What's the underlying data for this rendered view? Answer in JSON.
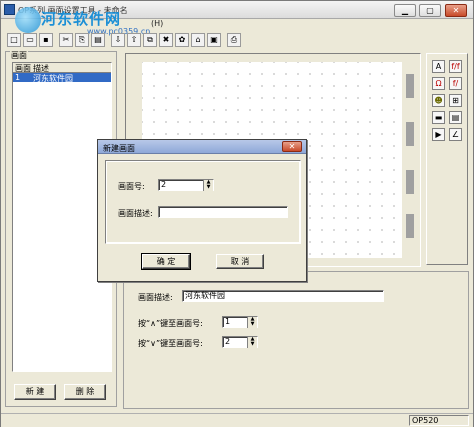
{
  "window": {
    "title": "OP系列 画面设置工具 - 未命名",
    "menu_fragment": "(H)",
    "buttons": {
      "minimize": "▁",
      "maximize": "▢",
      "close": "✕"
    }
  },
  "watermark": {
    "text": "河东软件网",
    "url": "www.pc0359.cn"
  },
  "left_panel": {
    "group_title": "画面",
    "columns": [
      "画面",
      "描述"
    ],
    "rows": [
      {
        "id": "1",
        "desc": "河东软件园"
      }
    ],
    "new_button": "新 建",
    "delete_button": "删 除"
  },
  "right_toolbox": {
    "tools": [
      "A",
      "f/f",
      "Ω",
      "f/",
      "☻",
      "⊞",
      "▬",
      "▤",
      "▶",
      "∠"
    ]
  },
  "properties": {
    "desc_label": "画面描述:",
    "desc_value": "河东软件园",
    "up_label": "按“∧”键至画面号:",
    "up_value": "1",
    "down_label": "按“∨”键至画面号:",
    "down_value": "2"
  },
  "dialog": {
    "title": "新建画面",
    "close": "✕",
    "num_label": "画面号:",
    "num_value": "2",
    "desc_label": "画面描述:",
    "desc_value": "",
    "ok": "确 定",
    "cancel": "取 消"
  },
  "status": {
    "model": "OP520"
  },
  "colors": {
    "selection": "#316ac5",
    "watermark": "#1b8fd6"
  }
}
